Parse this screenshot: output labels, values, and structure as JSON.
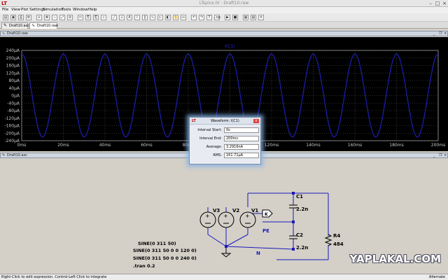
{
  "app": {
    "window_title": "LTspice IV - Draft10.raw",
    "logo_text": "LT"
  },
  "menu": [
    "File",
    "View",
    "Plot Settings",
    "Simulation",
    "Tools",
    "Window",
    "Help"
  ],
  "toolbar": {
    "buttons": [
      "open",
      "save",
      "print",
      "setup",
      "zoom-in",
      "pan",
      "zoom-out",
      "zoom-fit",
      "cancel",
      "cut",
      "copy",
      "paste",
      "find",
      "draw-wire",
      "ground",
      "label",
      "resistor",
      "capacitor",
      "inductor",
      "diode",
      "component",
      "move",
      "drag",
      "undo",
      "redo",
      "text",
      "spice-directive",
      "run",
      "halt",
      "tile",
      "cascade",
      "close-windows"
    ]
  },
  "tabs": [
    {
      "label": "Draft10.asc",
      "active": false
    },
    {
      "label": "Draft10.raw",
      "active": true
    }
  ],
  "plot_window": {
    "title": "Draft10.raw",
    "trace_label": "I(C1)"
  },
  "chart_data": {
    "type": "line",
    "title": "",
    "series": [
      {
        "name": "I(C1)",
        "color": "#1a1a9e",
        "amplitude": 220,
        "frequency_hz": 50,
        "phase_deg": 90
      }
    ],
    "x_range": [
      0,
      200
    ],
    "x_unit": "ms",
    "y_range": [
      -240,
      240
    ],
    "xticks": [
      "0ms",
      "20ms",
      "40ms",
      "60ms",
      "80ms",
      "100ms",
      "120ms",
      "140ms",
      "160ms",
      "180ms",
      "200ms"
    ],
    "yticks": [
      "240µA",
      "200µA",
      "160µA",
      "120µA",
      "80µA",
      "40µA",
      "0µA",
      "-40µA",
      "-80µA",
      "-120µA",
      "-160µA",
      "-200µA",
      "-240µA"
    ],
    "grid": true,
    "background": "#000000"
  },
  "dialog": {
    "title": "Waveform: I(C1)",
    "rows": [
      {
        "label": "Interval Start:",
        "value": "0s"
      },
      {
        "label": "Interval End:",
        "value": "200ms"
      },
      {
        "label": "Average:",
        "value": "3.2916nA"
      },
      {
        "label": "RMS:",
        "value": "161.71µA"
      }
    ]
  },
  "schematic_window": {
    "title": "Draft10.asc",
    "components": {
      "v3": "V3",
      "v2": "V2",
      "v1": "V1",
      "c1": "C1",
      "c1_value": "2.2n",
      "c2": "C2",
      "c2_value": "2.2n",
      "r4": "R4",
      "r4_value": "484"
    },
    "net_labels": {
      "k": "K",
      "pe": "PE",
      "n": "N"
    },
    "directives": [
      "SINE(0 311 50)",
      "SINE(0 311 50 0 0 120 0)",
      "SINE(0 311 50 0 0 240 0)",
      ".tran 0.2"
    ]
  },
  "status": {
    "left": "Right-Click to edit expression. Control-Left Click to integrate",
    "right": "Alternate"
  },
  "watermark": "YAPLAKAL.COM"
}
